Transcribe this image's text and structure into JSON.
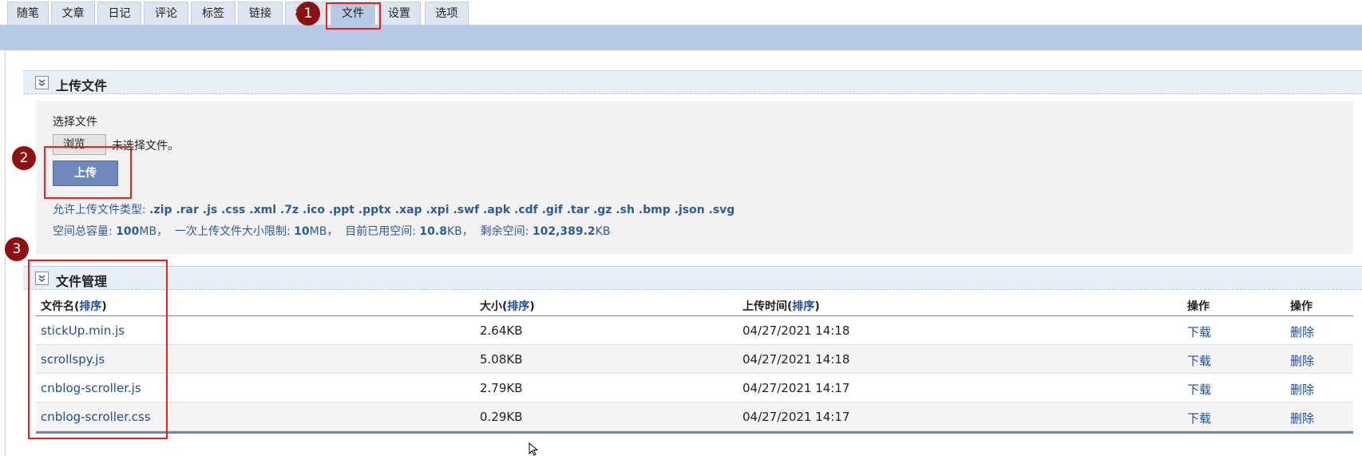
{
  "tabs": [
    "随笔",
    "文章",
    "日记",
    "评论",
    "标签",
    "链接",
    "相册",
    "文件",
    "设置",
    "选项"
  ],
  "active_tab": "文件",
  "upload": {
    "title": "上传文件",
    "choose_label": "选择文件",
    "browse_label": "浏览...",
    "no_file_text": "未选择文件。",
    "upload_button": "上传",
    "allowed_prefix": "允许上传文件类型:",
    "allowed_types": ".zip .rar .js .css .xml .7z .ico .ppt .pptx .xap .xpi .swf .apk .cdf .gif .tar .gz .sh .bmp .json .svg",
    "quota": {
      "total_label": "空间总容量:",
      "total_value": "100",
      "total_unit": "MB，",
      "single_label": "一次上传文件大小限制:",
      "single_value": "10",
      "single_unit": "MB，",
      "used_label": "目前已用空间:",
      "used_value": "10.8",
      "used_unit": "KB，",
      "free_label": "剩余空间:",
      "free_value": "102,389.2",
      "free_unit": "KB"
    }
  },
  "files": {
    "title": "文件管理",
    "headers": {
      "name": "文件名(",
      "size": "大小(",
      "time": "上传时间(",
      "sort": "排序",
      "close": ")",
      "op1": "操作",
      "op2": "操作"
    },
    "rows": [
      {
        "name": "stickUp.min.js",
        "size": "2.64KB",
        "time": "04/27/2021 14:18",
        "download": "下载",
        "delete": "删除"
      },
      {
        "name": "scrollspy.js",
        "size": "5.08KB",
        "time": "04/27/2021 14:18",
        "download": "下载",
        "delete": "删除"
      },
      {
        "name": "cnblog-scroller.js",
        "size": "2.79KB",
        "time": "04/27/2021 14:17",
        "download": "下载",
        "delete": "删除"
      },
      {
        "name": "cnblog-scroller.css",
        "size": "0.29KB",
        "time": "04/27/2021 14:17",
        "download": "下载",
        "delete": "删除"
      }
    ]
  },
  "annotations": [
    "1",
    "2",
    "3"
  ],
  "colors": {
    "link": "#1f4f8f",
    "band": "#b8cbe6",
    "annotation": "#e02424",
    "badge": "#8a1212"
  }
}
